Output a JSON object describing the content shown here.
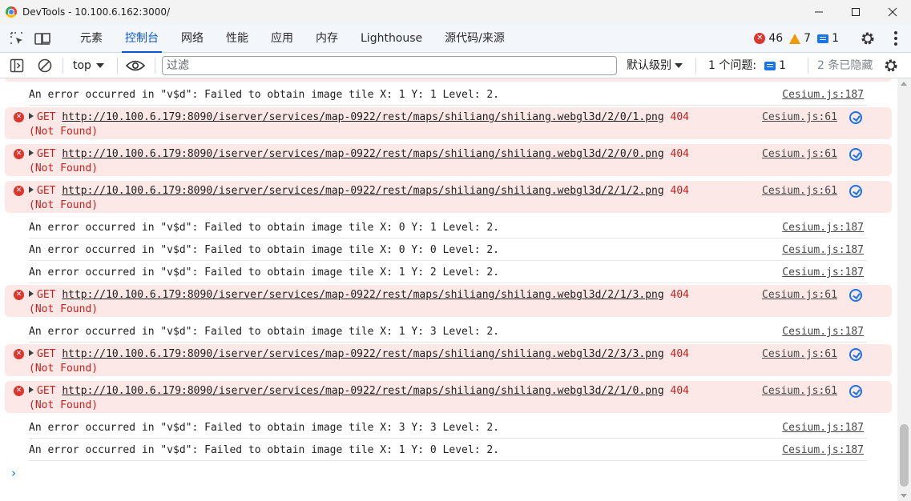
{
  "window": {
    "title": "DevTools - 10.100.6.162:3000/"
  },
  "tabs": [
    "元素",
    "控制台",
    "网络",
    "性能",
    "应用",
    "内存",
    "Lighthouse",
    "源代码/来源"
  ],
  "active_tab": "控制台",
  "counts": {
    "errors": "46",
    "warnings": "7",
    "messages": "1"
  },
  "toolbar": {
    "context": "top",
    "filter_placeholder": "过滤",
    "levels": "默认级别",
    "issues_label": "1 个问题:",
    "issues_count": "1",
    "hidden": "2 条已隐藏"
  },
  "console": {
    "partial_top": "",
    "rows": [
      {
        "type": "plain",
        "text": "An error occurred in \"v$d\": Failed to obtain image tile X: 1 Y: 1 Level: 2.",
        "source": "Cesium.js:187"
      },
      {
        "type": "error",
        "method": "GET",
        "url": "http://10.100.6.179:8090/iserver/services/map-0922/rest/maps/shiliang/shiliang.webgl3d/2/0/1.png",
        "status": "404",
        "status_text": "(Not Found)",
        "source": "Cesium.js:61"
      },
      {
        "type": "error",
        "method": "GET",
        "url": "http://10.100.6.179:8090/iserver/services/map-0922/rest/maps/shiliang/shiliang.webgl3d/2/0/0.png",
        "status": "404",
        "status_text": "(Not Found)",
        "source": "Cesium.js:61"
      },
      {
        "type": "error",
        "method": "GET",
        "url": "http://10.100.6.179:8090/iserver/services/map-0922/rest/maps/shiliang/shiliang.webgl3d/2/1/2.png",
        "status": "404",
        "status_text": "(Not Found)",
        "source": "Cesium.js:61"
      },
      {
        "type": "plain",
        "text": "An error occurred in \"v$d\": Failed to obtain image tile X: 0 Y: 1 Level: 2.",
        "source": "Cesium.js:187"
      },
      {
        "type": "plain",
        "text": "An error occurred in \"v$d\": Failed to obtain image tile X: 0 Y: 0 Level: 2.",
        "source": "Cesium.js:187"
      },
      {
        "type": "plain",
        "text": "An error occurred in \"v$d\": Failed to obtain image tile X: 1 Y: 2 Level: 2.",
        "source": "Cesium.js:187"
      },
      {
        "type": "error",
        "method": "GET",
        "url": "http://10.100.6.179:8090/iserver/services/map-0922/rest/maps/shiliang/shiliang.webgl3d/2/1/3.png",
        "status": "404",
        "status_text": "(Not Found)",
        "source": "Cesium.js:61"
      },
      {
        "type": "plain",
        "text": "An error occurred in \"v$d\": Failed to obtain image tile X: 1 Y: 3 Level: 2.",
        "source": "Cesium.js:187"
      },
      {
        "type": "error",
        "method": "GET",
        "url": "http://10.100.6.179:8090/iserver/services/map-0922/rest/maps/shiliang/shiliang.webgl3d/2/3/3.png",
        "status": "404",
        "status_text": "(Not Found)",
        "source": "Cesium.js:61"
      },
      {
        "type": "error",
        "method": "GET",
        "url": "http://10.100.6.179:8090/iserver/services/map-0922/rest/maps/shiliang/shiliang.webgl3d/2/1/0.png",
        "status": "404",
        "status_text": "(Not Found)",
        "source": "Cesium.js:61"
      },
      {
        "type": "plain",
        "text": "An error occurred in \"v$d\": Failed to obtain image tile X: 3 Y: 3 Level: 2.",
        "source": "Cesium.js:187"
      },
      {
        "type": "plain",
        "text": "An error occurred in \"v$d\": Failed to obtain image tile X: 1 Y: 0 Level: 2.",
        "source": "Cesium.js:187"
      }
    ]
  },
  "icons": {
    "inspect": "inspect-element-icon",
    "device": "device-toolbar-icon",
    "sidebar": "sidebar-toggle-icon",
    "clear": "clear-console-icon",
    "eye": "live-expression-icon",
    "gear": "settings-gear-icon",
    "more": "more-options-icon",
    "network": "network-request-icon"
  },
  "colors": {
    "accent": "#0b57d0",
    "error_bg": "#fce8e6",
    "error_text": "#c5221f"
  }
}
